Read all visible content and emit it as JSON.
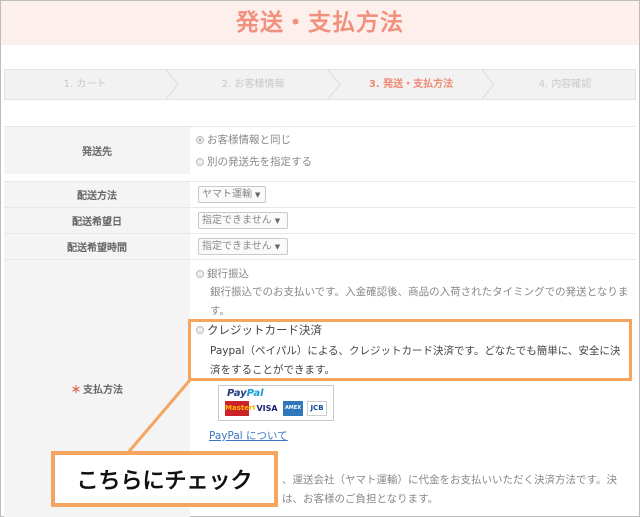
{
  "page": {
    "title": "発送・支払方法"
  },
  "steps": [
    {
      "label": "1. カート",
      "active": false
    },
    {
      "label": "2. お客様情報",
      "active": false
    },
    {
      "label": "3. 発送・支払方法",
      "active": true
    },
    {
      "label": "4. 内容確認",
      "active": false
    }
  ],
  "shipping_to": {
    "label": "発送先",
    "options": [
      {
        "label": "お客様情報と同じ",
        "checked": true
      },
      {
        "label": "別の発送先を指定する",
        "checked": false
      }
    ]
  },
  "delivery_method": {
    "label": "配送方法",
    "value": "ヤマト運輸"
  },
  "delivery_date": {
    "label": "配送希望日",
    "value": "指定できません"
  },
  "delivery_time": {
    "label": "配送希望時間",
    "value": "指定できません"
  },
  "payment": {
    "required_mark": "＊",
    "label": "支払方法",
    "bank": {
      "title": "銀行振込",
      "description_line1": "銀行振込でのお支払いです。入金確認後、商品の入荷されたタイミングでの発送となりま",
      "description_line2": "す。"
    },
    "credit": {
      "title": "クレジットカード決済",
      "description_line1": "Paypal（ペイパル）による、クレジットカード決済です。どなたでも簡単に、安全に決",
      "description_line2": "済をすることができます。",
      "paypal_logo_a": "Pay",
      "paypal_logo_b": "Pal",
      "cards": [
        "MasterCard",
        "VISA",
        "AMEX",
        "JCB"
      ],
      "paypal_link": "PayPal について"
    },
    "cod": {
      "description_line1": "、運送会社（ヤマト運輸）に代金をお支払いいただく決済方法です。決",
      "description_line2": "は、お客様のご負担となります。"
    }
  },
  "callout": {
    "text": "こちらにチェック"
  },
  "colors": {
    "accent": "#f0907d",
    "highlight": "#f5a55e",
    "link": "#3b76c4"
  }
}
